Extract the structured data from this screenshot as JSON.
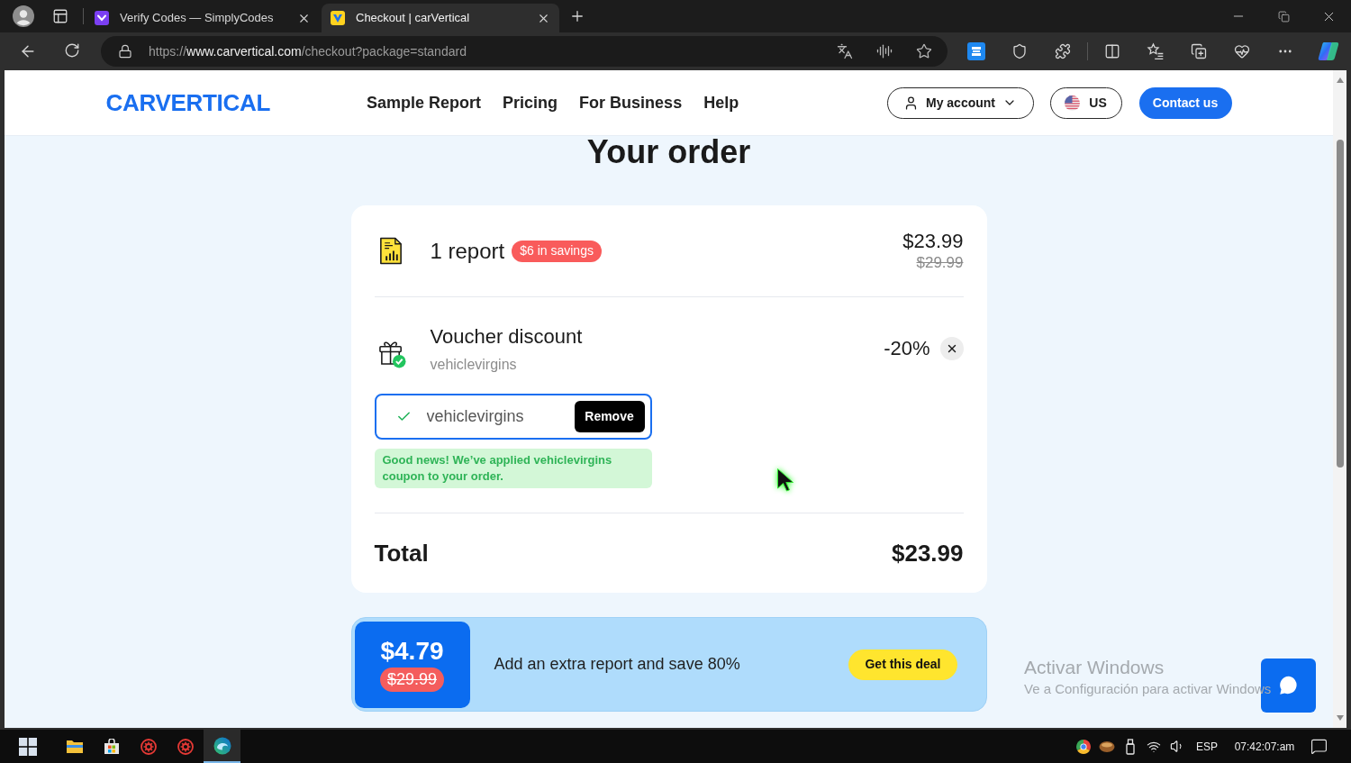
{
  "browser": {
    "tabs": [
      {
        "title": "Verify Codes — SimplyCodes",
        "selected": false
      },
      {
        "title": "Checkout | carVertical",
        "selected": true
      }
    ],
    "url": {
      "scheme": "https://",
      "host": "www.carvertical.com",
      "path": "/checkout?package=standard"
    }
  },
  "header": {
    "logo": "CARVERTICAL",
    "nav": [
      "Sample Report",
      "Pricing",
      "For Business",
      "Help"
    ],
    "account": "My account",
    "region": "US",
    "contact": "Contact us"
  },
  "order": {
    "title": "Your order",
    "item": {
      "name": "1 report",
      "badge": "$6 in savings",
      "price": "$23.99",
      "old_price": "$29.99"
    },
    "voucher": {
      "title": "Voucher discount",
      "code": "vehiclevirgins",
      "discount": "-20%"
    },
    "coupon_field": {
      "value": "vehiclevirgins",
      "button": "Remove"
    },
    "message": "Good news! We’ve applied vehiclevirgins coupon to your order.",
    "total": {
      "label": "Total",
      "amount": "$23.99"
    }
  },
  "deal": {
    "price": "$4.79",
    "old_price": "$29.99",
    "text": "Add an extra report and save 80%",
    "button": "Get this deal"
  },
  "windows_notice": {
    "title": "Activar Windows",
    "text": "Ve a Configuración para activar Windows"
  },
  "taskbar": {
    "apps": [
      {
        "kind": "explorer",
        "selected": false
      },
      {
        "kind": "store",
        "selected": false
      },
      {
        "kind": "gear",
        "selected": false
      },
      {
        "kind": "gear",
        "selected": false
      },
      {
        "kind": "edge",
        "selected": true
      }
    ],
    "language": "ESP",
    "clock": "07:42:07:am"
  }
}
